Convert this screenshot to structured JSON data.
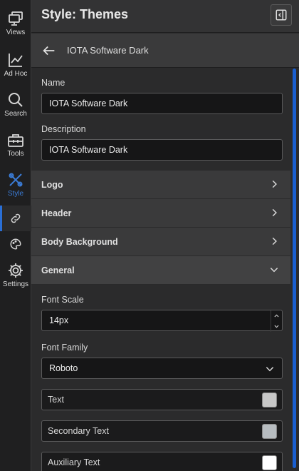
{
  "rail": {
    "items": [
      {
        "label": "Views",
        "icon": "views-icon"
      },
      {
        "label": "Ad Hoc",
        "icon": "chart-line-icon"
      },
      {
        "label": "Search",
        "icon": "search-icon"
      },
      {
        "label": "Tools",
        "icon": "toolbox-icon"
      },
      {
        "label": "Style",
        "icon": "style-icon"
      },
      {
        "label": "Settings",
        "icon": "gear-icon"
      }
    ],
    "sub_icons": [
      "link-style-icon",
      "palette-icon"
    ],
    "active_color": "#2a6fd6"
  },
  "panel": {
    "title": "Style: Themes",
    "collapse_icon": "collapse-panel-icon",
    "breadcrumb_title": "IOTA Software Dark"
  },
  "form": {
    "name_label": "Name",
    "name_value": "IOTA Software Dark",
    "description_label": "Description",
    "description_value": "IOTA Software Dark"
  },
  "sections": {
    "logo": "Logo",
    "header": "Header",
    "body_background": "Body Background",
    "general": "General"
  },
  "general": {
    "font_scale_label": "Font Scale",
    "font_scale_value": "14px",
    "font_family_label": "Font Family",
    "font_family_value": "Roboto",
    "colors": [
      {
        "label": "Text",
        "swatch": "#c7c7c7"
      },
      {
        "label": "Secondary Text",
        "swatch": "#b7bcc0"
      },
      {
        "label": "Auxiliary Text",
        "swatch": "#ffffff"
      }
    ]
  }
}
